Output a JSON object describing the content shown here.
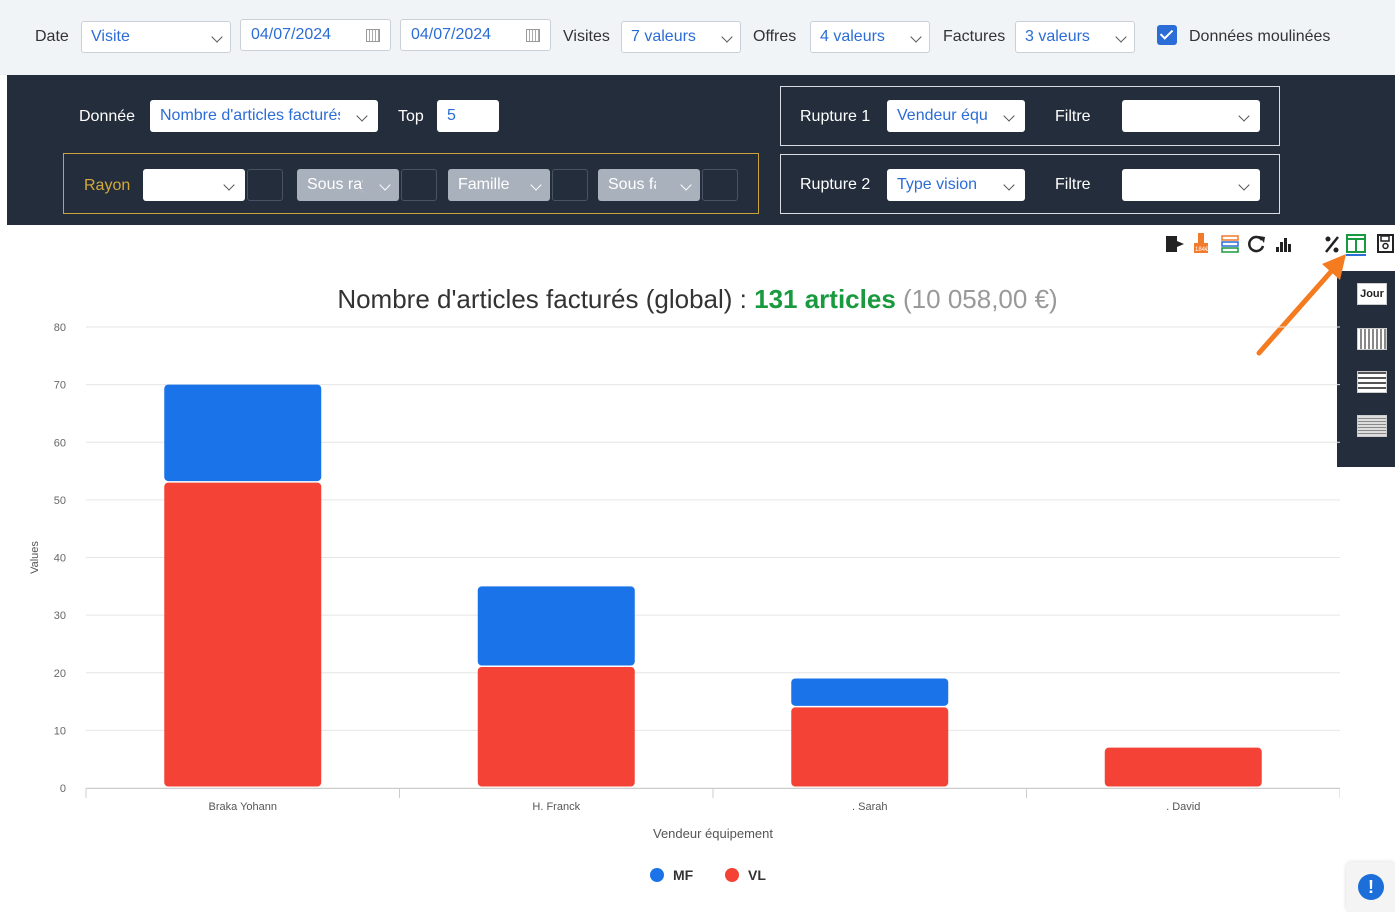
{
  "filters": {
    "date_label": "Date",
    "date_type_value": "Visite",
    "date_from": "04/07/2024",
    "date_to": "04/07/2024",
    "visites_label": "Visites",
    "visites_value": "7 valeurs",
    "offres_label": "Offres",
    "offres_value": "4 valeurs",
    "factures_label": "Factures",
    "factures_value": "3 valeurs",
    "donnees_moulinees_label": "Données moulinées",
    "donnees_moulinees_checked": true
  },
  "panel": {
    "donnee_label": "Donnée",
    "donnee_value": "Nombre d'articles facturés",
    "top_label": "Top",
    "top_value": "5",
    "rupture1_label": "Rupture 1",
    "rupture1_value": "Vendeur équipement",
    "rupture2_label": "Rupture 2",
    "rupture2_value": "Type vision",
    "filtre_label": "Filtre",
    "rayon_label": "Rayon",
    "sous_rayon": "Sous rayon",
    "famille": "Famille",
    "sous_famille": "Sous famille"
  },
  "toolbar": {
    "icons": [
      "export-icon",
      "euro-icon",
      "stack-icon",
      "refresh-icon",
      "bar-chart-icon",
      "percent-icon",
      "table-view-icon",
      "save-icon"
    ]
  },
  "side_menu": {
    "items": [
      "Jour",
      "",
      "",
      ""
    ]
  },
  "chart_title": {
    "prefix": "Nombre d'articles facturés (global) : ",
    "highlight": "131 articles",
    "suffix": "(10 058,00 €)"
  },
  "colors": {
    "accent": "#2b6cd6",
    "mf": "#1a73e8",
    "vl": "#f44336",
    "highlight": "#1a9a3e",
    "dark_panel": "#242d3b"
  },
  "chart_data": {
    "type": "bar",
    "stacked": true,
    "categories": [
      "Braka Yohann",
      "H. Franck",
      ". Sarah",
      ". David"
    ],
    "series": [
      {
        "name": "VL",
        "values": [
          53,
          21,
          14,
          7
        ]
      },
      {
        "name": "MF",
        "values": [
          17,
          14,
          5,
          0
        ]
      }
    ],
    "xlabel": "Vendeur équipement",
    "ylabel": "Values",
    "ylim": [
      0,
      80
    ],
    "yticks": [
      0,
      10,
      20,
      30,
      40,
      50,
      60,
      70,
      80
    ],
    "grid": true,
    "legend": "bottom"
  }
}
